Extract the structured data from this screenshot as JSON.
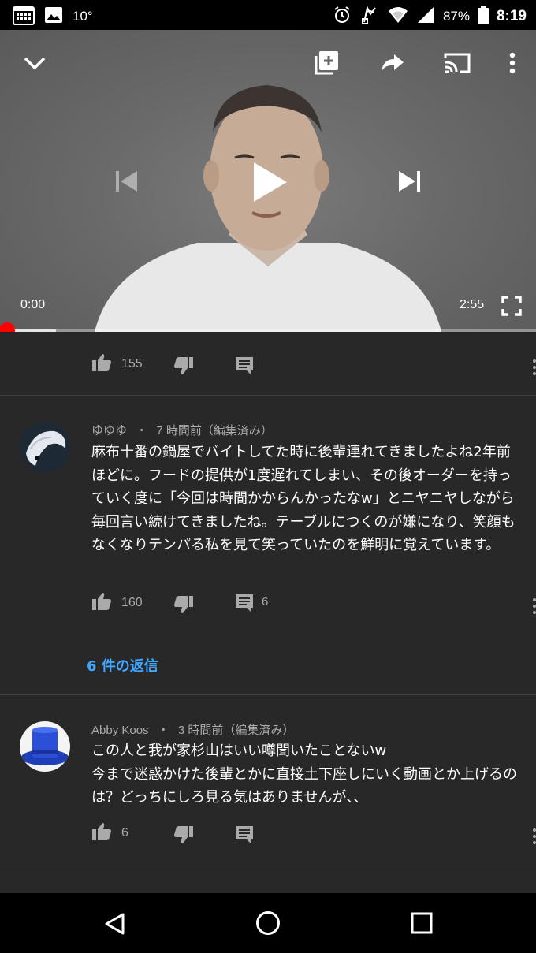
{
  "status_bar": {
    "temperature": "10°",
    "battery": "87%",
    "time": "8:19",
    "icons": [
      "calendar-icon",
      "image-icon",
      "alarm-icon",
      "nfc-icon",
      "wifi-icon",
      "signal-icon",
      "battery-icon"
    ]
  },
  "player": {
    "current_time": "0:00",
    "duration": "2:55",
    "progress_fraction": 0,
    "buffered_fraction": 0.105,
    "top_icons": [
      "collapse-chevron-icon",
      "add-to-playlist-icon",
      "share-icon",
      "cast-icon",
      "more-options-icon"
    ],
    "center_icons": [
      "previous-icon",
      "play-icon",
      "next-icon"
    ]
  },
  "comments": [
    {
      "likes": "155",
      "replies_count": ""
    },
    {
      "author": "ゆゆゆ",
      "separator": "・",
      "time": "7 時間前（編集済み）",
      "text": "麻布十番の鍋屋でバイトしてた時に後輩連れてきましたよね2年前ほどに。フードの提供が1度遅れてしまい、その後オーダーを持っていく度に「今回は時間かからんかったなw」とニヤニヤしながら毎回言い続けてきましたね。テーブルにつくのが嫌になり、笑顔もなくなりテンパる私を見て笑っていたのを鮮明に覚えています。",
      "likes": "160",
      "replies_count": "6",
      "replies_link": "6 件の返信"
    },
    {
      "author": "Abby Koos",
      "separator": "・",
      "time": "3 時間前（編集済み）",
      "text_line1": "この人と我が家杉山はいい噂聞いたことないw",
      "text_line2": "今まで迷惑かけた後輩とかに直接土下座しにいく動画とか上げるのは？どっちにしろ見る気はありませんが、、",
      "likes": "6",
      "replies_count": ""
    }
  ],
  "colors": {
    "background": "#282828",
    "accent_red": "#ff0000",
    "link_blue": "#3ea6ff",
    "muted_text": "#aaaaaa"
  },
  "nav_icons": [
    "back-icon",
    "home-icon",
    "recents-icon"
  ]
}
